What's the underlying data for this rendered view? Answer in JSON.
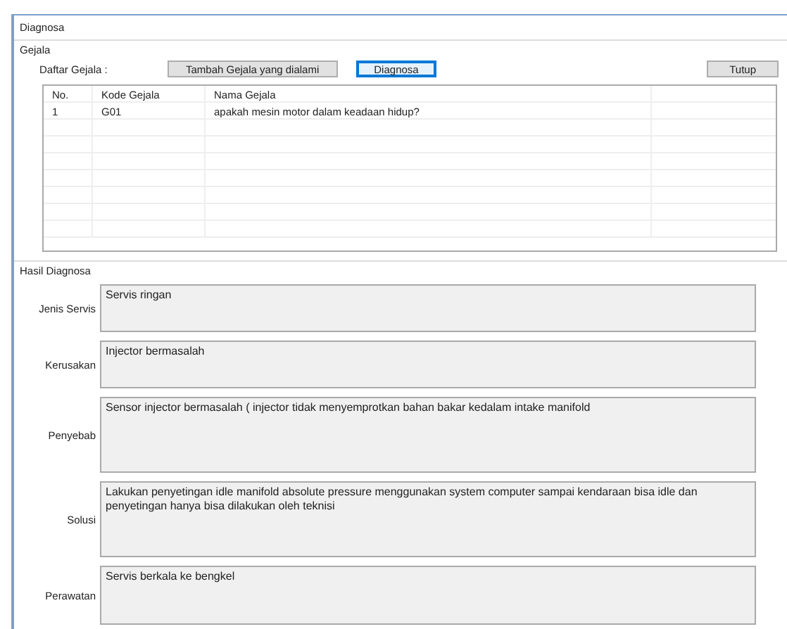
{
  "window": {
    "title": "Diagnosa"
  },
  "gejala": {
    "title": "Gejala",
    "list_label": "Daftar Gejala :",
    "buttons": [
      {
        "label": "Tambah Gejala yang dialami",
        "focused": false
      },
      {
        "label": "Diagnosa",
        "focused": true
      }
    ],
    "close_button": "Tutup",
    "table": {
      "columns": [
        "No.",
        "Kode Gejala",
        "Nama Gejala"
      ],
      "rows": [
        [
          "1",
          "G01",
          "apakah mesin motor dalam keadaan hidup?"
        ]
      ]
    }
  },
  "hasil": {
    "title": "Hasil Diagnosa",
    "fields": [
      {
        "label": "Jenis Servis",
        "value": "Servis ringan"
      },
      {
        "label": "Kerusakan",
        "value": "Injector bermasalah"
      },
      {
        "label": "Penyebab",
        "value": "Sensor injector bermasalah ( injector  tidak menyemprotkan bahan bakar kedalam intake manifold"
      },
      {
        "label": "Solusi",
        "value": "Lakukan penyetingan idle manifold absolute pressure menggunakan system computer  sampai kendaraan bisa idle dan penyetingan  hanya bisa dilakukan oleh teknisi"
      },
      {
        "label": "Perawatan",
        "value": "Servis berkala ke bengkel"
      }
    ]
  }
}
